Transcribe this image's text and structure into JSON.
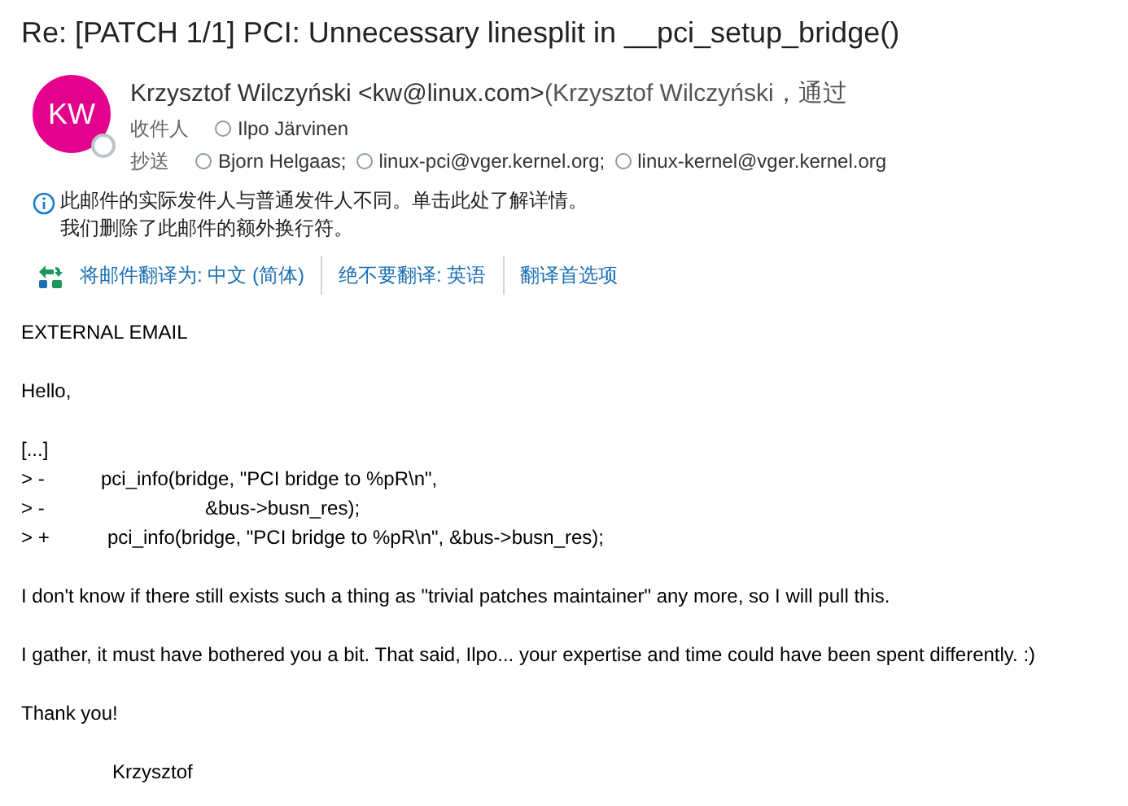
{
  "subject": "Re: [PATCH 1/1] PCI: Unnecessary linesplit in __pci_setup_bridge()",
  "sender": {
    "initials": "KW",
    "name": "Krzysztof Wilczyński <kw@linux.com>",
    "via": "(Krzysztof Wilczyński，通过"
  },
  "to": {
    "label": "收件人",
    "recipients": [
      "Ilpo Järvinen"
    ]
  },
  "cc": {
    "label": "抄送",
    "recipients": [
      "Bjorn Helgaas;",
      "linux-pci@vger.kernel.org;",
      "linux-kernel@vger.kernel.org"
    ]
  },
  "notice": [
    "此邮件的实际发件人与普通发件人不同。单击此处了解详情。",
    "我们删除了此邮件的额外换行符。"
  ],
  "translate_links": [
    "将邮件翻译为: 中文 (简体)",
    "绝不要翻译: 英语",
    "翻译首选项"
  ],
  "body": [
    {
      "kind": "text",
      "text": "EXTERNAL EMAIL"
    },
    {
      "kind": "text",
      "text": "Hello,"
    },
    {
      "kind": "code",
      "lines": [
        {
          "kind": "elided",
          "prefix": "[...]"
        },
        {
          "kind": "call",
          "prefix": "> -",
          "code": "pci_info(bridge, \"PCI bridge to %pR\\n\","
        },
        {
          "kind": "continuation",
          "prefix": "> -",
          "code": "&bus->busn_res);"
        },
        {
          "kind": "added",
          "prefix": "> +",
          "code": "pci_info(bridge, \"PCI bridge to %pR\\n\", &bus->busn_res);"
        }
      ]
    },
    {
      "kind": "text",
      "text": "I don't know if there still exists such a thing as \"trivial patches maintainer\" any more, so I will pull this."
    },
    {
      "kind": "text",
      "text": "I gather, it must have bothered you a bit. That said, Ilpo... your expertise and time could have been spent differently. :)"
    },
    {
      "kind": "text",
      "text": "Thank you!"
    },
    {
      "kind": "signature",
      "text": "Krzysztof"
    }
  ]
}
